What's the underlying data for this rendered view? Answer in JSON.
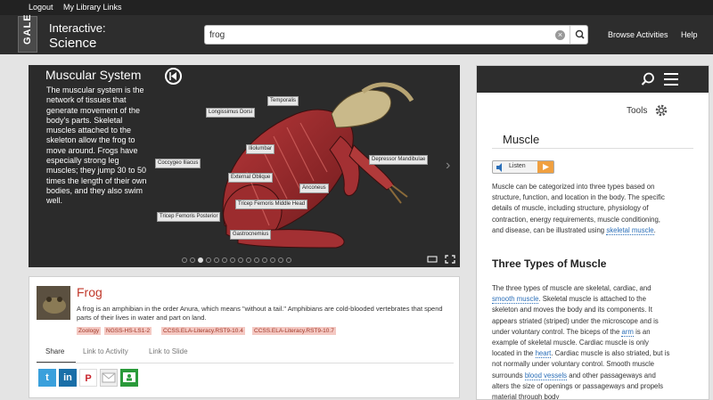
{
  "topbar": {
    "logout": "Logout",
    "library_links": "My Library Links"
  },
  "header": {
    "logo": "GALE",
    "brand_line1": "Interactive:",
    "brand_line2": "Science",
    "search_value": "frog",
    "browse": "Browse Activities",
    "help": "Help"
  },
  "media": {
    "title": "Muscular System",
    "description": "The muscular system is the network of tissues that generate movement of the body's parts. Skeletal muscles attached to the skeleton allow the frog to move around. Frogs have especially strong leg muscles; they jump 30 to 50 times the length of their own bodies, and they also swim well.",
    "labels": {
      "temporalis": "Temporalis",
      "longissimus": "Longissimus Dorsi",
      "iliolumbar": "Iliolumbar",
      "coccygeo": "Coccygeo Iliacus",
      "depressor": "Depressor Mandibulae",
      "external": "External Oblique",
      "anconeus": "Anconeus",
      "triceps_mid": "Tricep Femoris Middle Head",
      "triceps_post": "Tricep Femoris Posterior",
      "gastrocnemius": "Gastrocnemius"
    },
    "slides_total": 14,
    "slide_active": 3
  },
  "card": {
    "title": "Frog",
    "description": "A frog is an amphibian in the order Anura, which means \"without a tail.\" Amphibians are cold-blooded vertebrates that spend parts of their lives in water and part on land.",
    "tags": [
      "Zoology",
      "NGSS-HS-LS1-2",
      "CCSS.ELA-Literacy.RST9-10.4",
      "CCSS.ELA-Literacy.RST9-10.7"
    ],
    "tabs": [
      "Share",
      "Link to Activity",
      "Link to Slide"
    ],
    "share_icons": [
      "twitter-icon",
      "linkedin-icon",
      "pinterest-icon",
      "email-icon",
      "google-classroom-icon"
    ]
  },
  "article": {
    "tools": "Tools",
    "title": "Muscle",
    "listen": "Listen",
    "para1_a": "Muscle can be categorized into three types based on structure, function, and location in the body. The specific details of muscle, including structure, physiology of contraction, energy requirements, muscle conditioning, and disease, can be illustrated using ",
    "para1_link": "skeletal muscle",
    "para1_b": ".",
    "heading": "Three Types of Muscle",
    "p2_1": "The three types of muscle are skeletal, cardiac, and ",
    "p2_link1": "smooth muscle",
    "p2_2": ". Skeletal muscle is attached to the skeleton and moves the body and its components. It appears striated (striped) under the microscope and is under voluntary control. The biceps of the ",
    "p2_link2": "arm",
    "p2_3": " is an example of skeletal muscle. Cardiac muscle is only located in the ",
    "p2_link3": "heart",
    "p2_4": ". Cardiac muscle is also striated, but is not normally under voluntary control. Smooth muscle surrounds ",
    "p2_link4": "blood vessels",
    "p2_5": " and other passageways and alters the size of openings or passageways and propels material through body"
  },
  "colors": {
    "accent_red": "#c0392b",
    "link_blue": "#2a6eb8",
    "header_dark": "#2d2d2d"
  }
}
